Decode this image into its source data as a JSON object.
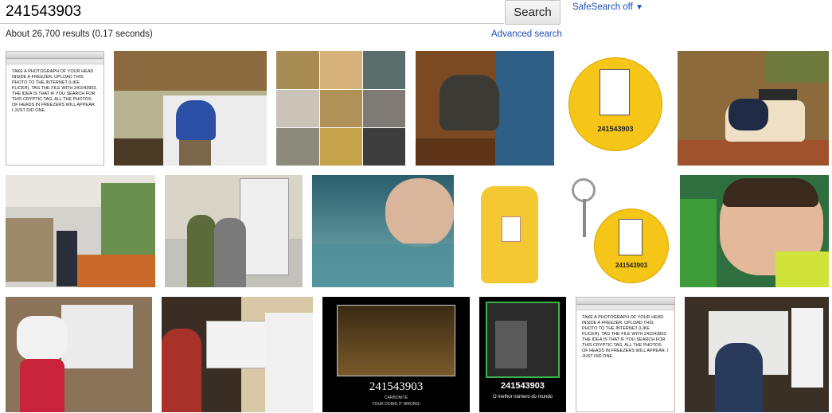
{
  "search": {
    "query": "241543903",
    "button_label": "Search",
    "safesearch_label": "SafeSearch off",
    "safesearch_caret": "▼"
  },
  "results": {
    "stats": "About 26,700 results (0.17 seconds)",
    "advanced_label": "Advanced search"
  },
  "images": {
    "note_text": "TAKE A PHOTOGRAPH OF YOUR HEAD INSIDE A FREEZER. UPLOAD THIS PHOTO TO THE INTERNET (LIKE FLICKR). TAG THE FILE WITH 241543903. THE IDEA IS THAT IF YOU SEARCH FOR THIS CRYPTIC TAG, ALL THE PHOTOS OF HEADS IN FREEZERS WILL APPEAR. I JUST DID ONE.",
    "button_number": "241543903",
    "poster_number": "241543903",
    "poster_small": "CARBONITE",
    "poster_tagline": "YOUR DOING IT WRONG!",
    "poster2_number": "241543903",
    "poster2_caption": "O melhor número do mundo"
  }
}
